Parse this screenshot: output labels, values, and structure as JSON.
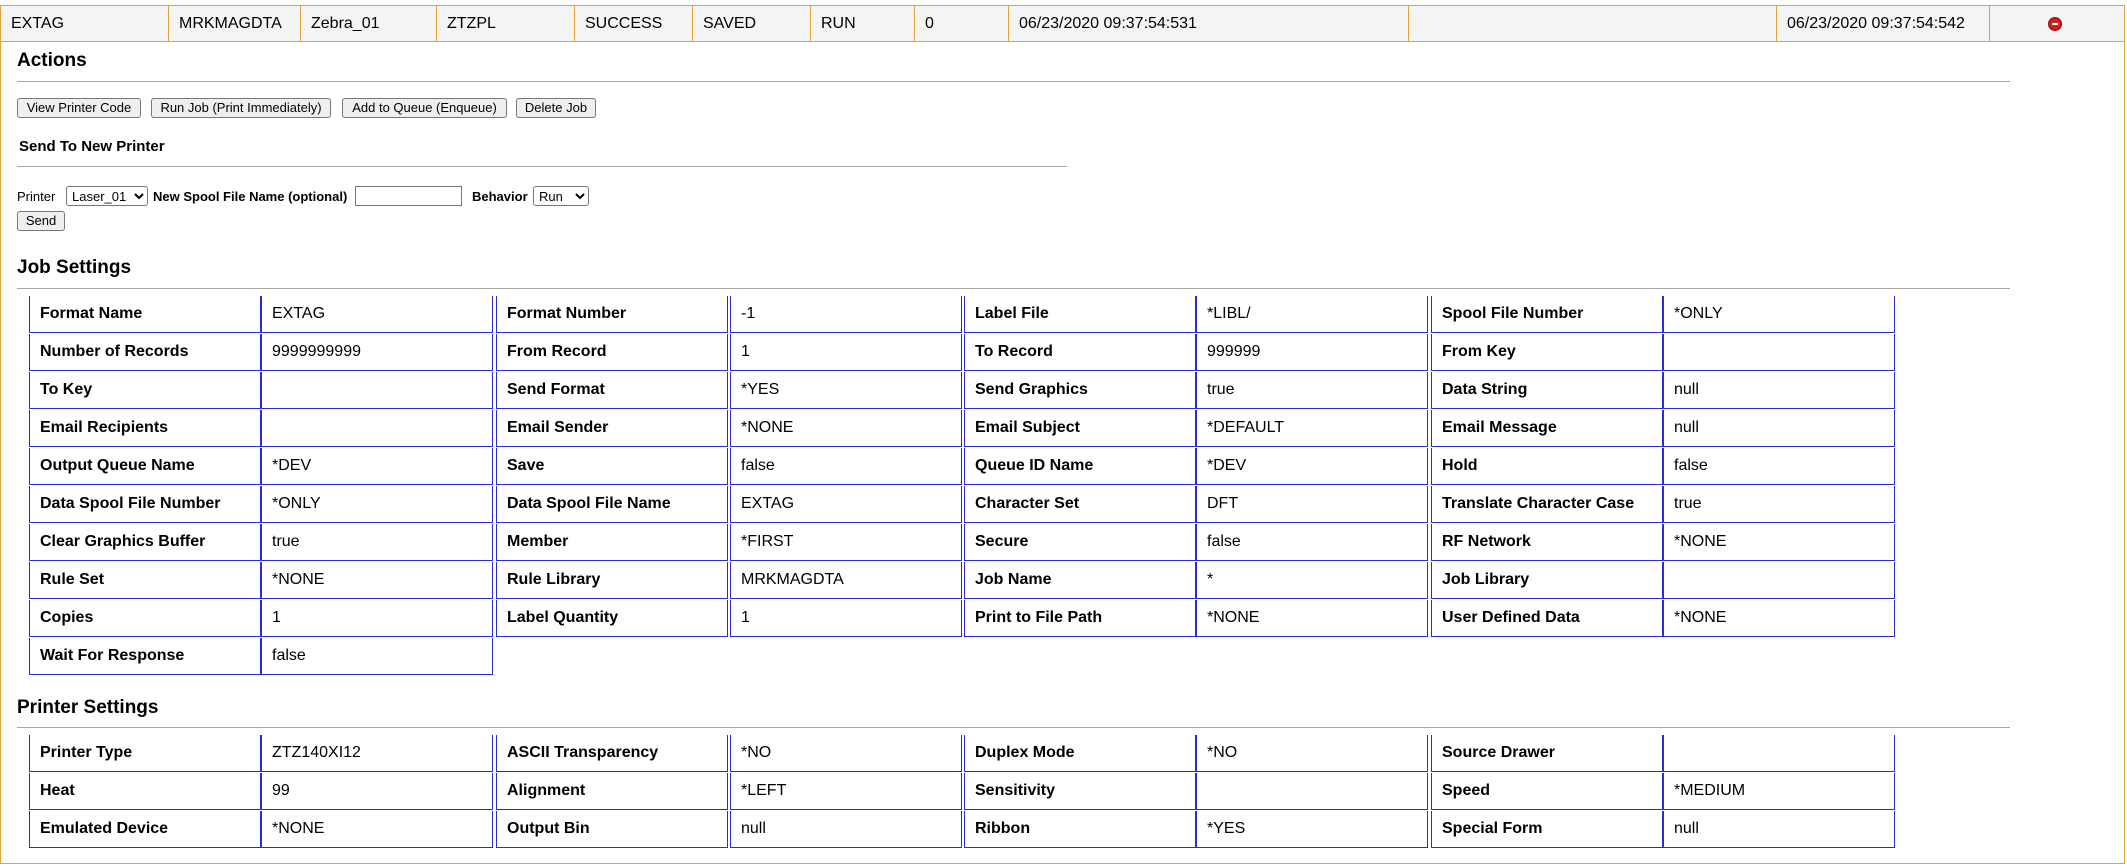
{
  "job_row": {
    "cells": [
      "EXTAG",
      "MRKMAGDTA",
      "Zebra_01",
      "ZTZPL",
      "SUCCESS",
      "SAVED",
      "RUN",
      "0",
      "06/23/2020 09:37:54:531",
      "",
      "06/23/2020 09:37:54:542"
    ],
    "remove_icon": "remove-circle-icon",
    "remove_color": "#cc1f1f"
  },
  "actions": {
    "title": "Actions",
    "buttons": [
      "View Printer Code",
      "Run Job (Print Immediately)",
      "Add to Queue (Enqueue)",
      "Delete Job"
    ]
  },
  "send_to_printer": {
    "title": "Send To New Printer",
    "printer_label": "Printer",
    "printer_value": "Laser_01",
    "spool_label": "New Spool File Name (optional)",
    "spool_value": "",
    "behavior_label": "Behavior",
    "behavior_value": "Run",
    "send_button": "Send"
  },
  "job_settings": {
    "title": "Job Settings",
    "rows": [
      [
        [
          "Format Name",
          "EXTAG"
        ],
        [
          "Format Number",
          "-1"
        ],
        [
          "Label File",
          "*LIBL/"
        ],
        [
          "Spool File Number",
          "*ONLY"
        ]
      ],
      [
        [
          "Number of Records",
          "9999999999"
        ],
        [
          "From Record",
          "1"
        ],
        [
          "To Record",
          "999999"
        ],
        [
          "From Key",
          ""
        ]
      ],
      [
        [
          "To Key",
          ""
        ],
        [
          "Send Format",
          "*YES"
        ],
        [
          "Send Graphics",
          "true"
        ],
        [
          "Data String",
          "null"
        ]
      ],
      [
        [
          "Email Recipients",
          ""
        ],
        [
          "Email Sender",
          "*NONE"
        ],
        [
          "Email Subject",
          "*DEFAULT"
        ],
        [
          "Email Message",
          "null"
        ]
      ],
      [
        [
          "Output Queue Name",
          "*DEV"
        ],
        [
          "Save",
          "false"
        ],
        [
          "Queue ID Name",
          "*DEV"
        ],
        [
          "Hold",
          "false"
        ]
      ],
      [
        [
          "Data Spool File Number",
          "*ONLY"
        ],
        [
          "Data Spool File Name",
          "EXTAG"
        ],
        [
          "Character Set",
          "DFT"
        ],
        [
          "Translate Character Case",
          "true"
        ]
      ],
      [
        [
          "Clear Graphics Buffer",
          "true"
        ],
        [
          "Member",
          "*FIRST"
        ],
        [
          "Secure",
          "false"
        ],
        [
          "RF Network",
          "*NONE"
        ]
      ],
      [
        [
          "Rule Set",
          "*NONE"
        ],
        [
          "Rule Library",
          "MRKMAGDTA"
        ],
        [
          "Job Name",
          "*"
        ],
        [
          "Job Library",
          ""
        ]
      ],
      [
        [
          "Copies",
          "1"
        ],
        [
          "Label Quantity",
          "1"
        ],
        [
          "Print to File Path",
          "*NONE"
        ],
        [
          "User Defined Data",
          "*NONE"
        ]
      ],
      [
        [
          "Wait For Response",
          "false"
        ]
      ]
    ]
  },
  "printer_settings": {
    "title": "Printer Settings",
    "rows": [
      [
        [
          "Printer Type",
          "ZTZ140XI12"
        ],
        [
          "ASCII Transparency",
          "*NO"
        ],
        [
          "Duplex Mode",
          "*NO"
        ],
        [
          "Source Drawer",
          ""
        ]
      ],
      [
        [
          "Heat",
          "99"
        ],
        [
          "Alignment",
          "*LEFT"
        ],
        [
          "Sensitivity",
          ""
        ],
        [
          "Speed",
          "*MEDIUM"
        ]
      ],
      [
        [
          "Emulated Device",
          "*NONE"
        ],
        [
          "Output Bin",
          "null"
        ],
        [
          "Ribbon",
          "*YES"
        ],
        [
          "Special Form",
          "null"
        ]
      ]
    ]
  },
  "colors": {
    "accent_border": "#e0a43a",
    "grid_border": "#2b2bd9",
    "header_bg": "#f4f4f4"
  }
}
